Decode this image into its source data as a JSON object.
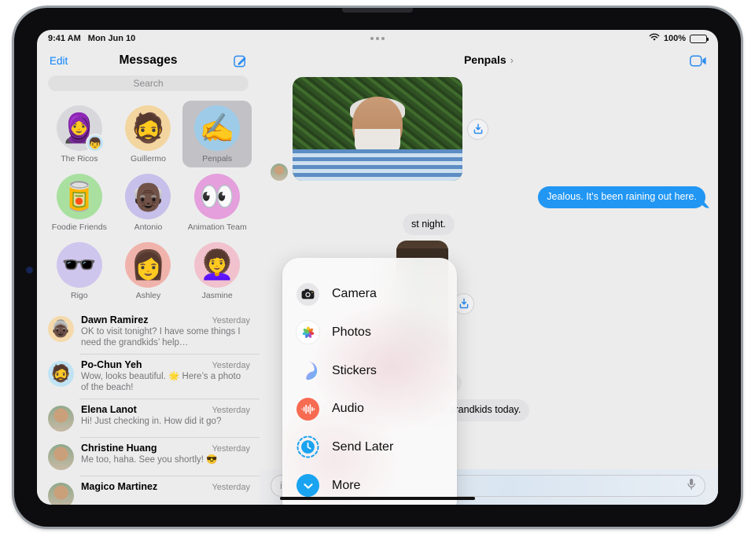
{
  "status_bar": {
    "time": "9:41 AM",
    "date": "Mon Jun 10",
    "battery_percent": "100%",
    "wifi_icon": "wifi-icon",
    "battery_icon": "battery-icon",
    "multitask_icon": "multitasking-controls-icon"
  },
  "sidebar": {
    "edit_label": "Edit",
    "title": "Messages",
    "compose_icon": "compose-icon",
    "search": {
      "placeholder": "Search",
      "value": ""
    },
    "pinned": [
      {
        "label": "The Ricos",
        "emoji": "🧕",
        "bg": "#d8d8dc",
        "selected": false,
        "sub_emoji": "👦"
      },
      {
        "label": "Guillermo",
        "emoji": "🧔",
        "bg": "#f3d5a0",
        "selected": false,
        "sub_emoji": ""
      },
      {
        "label": "Penpals",
        "emoji": "✍️",
        "bg": "#9ecbe8",
        "selected": true,
        "sub_emoji": ""
      },
      {
        "label": "Foodie Friends",
        "emoji": "🥫",
        "bg": "#a9e0a0",
        "selected": false,
        "sub_emoji": ""
      },
      {
        "label": "Antonio",
        "emoji": "👴🏿",
        "bg": "#c6c0ea",
        "selected": false,
        "sub_emoji": ""
      },
      {
        "label": "Animation Team",
        "emoji": "👀",
        "bg": "#e49fdc",
        "selected": false,
        "sub_emoji": ""
      },
      {
        "label": "Rigo",
        "emoji": "🕶️",
        "bg": "#cfc6ee",
        "selected": false,
        "sub_emoji": ""
      },
      {
        "label": "Ashley",
        "emoji": "👩",
        "bg": "#f0b3ac",
        "selected": false,
        "sub_emoji": ""
      },
      {
        "label": "Jasmine",
        "emoji": "👩‍🦱",
        "bg": "#f1c2cd",
        "selected": false,
        "sub_emoji": ""
      }
    ],
    "conversations": [
      {
        "name": "Dawn Ramirez",
        "time": "Yesterday",
        "preview": "OK to visit tonight? I have some things I need the grandkids’ help…",
        "avatar_bg": "#f5d9ab",
        "avatar_emoji": "👵🏿"
      },
      {
        "name": "Po-Chun Yeh",
        "time": "Yesterday",
        "preview": "Wow, looks beautiful. 🌟 Here’s a photo of the beach!",
        "avatar_bg": "#bfe3f4",
        "avatar_emoji": "🧔"
      },
      {
        "name": "Elena Lanot",
        "time": "Yesterday",
        "preview": "Hi! Just checking in. How did it go?",
        "avatar_bg": "#9fb8a0",
        "avatar_emoji": ""
      },
      {
        "name": "Christine Huang",
        "time": "Yesterday",
        "preview": "Me too, haha. See you shortly! 😎",
        "avatar_bg": "#e0a263",
        "avatar_emoji": ""
      },
      {
        "name": "Magico Martinez",
        "time": "Yesterday",
        "preview": "",
        "avatar_bg": "#6ba4d8",
        "avatar_emoji": ""
      }
    ]
  },
  "chat": {
    "title": "Penpals",
    "chevron": "›",
    "facetime_icon": "facetime-video-icon",
    "messages": [
      {
        "type": "photo",
        "direction": "in",
        "save_icon": "save-to-photos-icon",
        "kind": "hedge-selfie"
      },
      {
        "type": "text",
        "direction": "out",
        "text": "Jealous. It's been raining out here."
      },
      {
        "type": "text",
        "direction": "in",
        "text": "st night."
      },
      {
        "type": "photo",
        "direction": "in",
        "save_icon": "save-to-photos-icon",
        "kind": "green-door"
      },
      {
        "type": "text",
        "direction": "in",
        "text": "dress up."
      },
      {
        "type": "text",
        "direction": "in",
        "text": "with the grandkids today."
      }
    ],
    "composer": {
      "placeholder": "iMessage",
      "value": "",
      "mic_icon": "microphone-icon"
    }
  },
  "plus_menu": {
    "items": [
      {
        "label": "Camera",
        "icon": "camera-icon",
        "bg": "#e6e6e8",
        "fg": "#1c1c1e"
      },
      {
        "label": "Photos",
        "icon": "photos-icon",
        "bg": "#ffffff",
        "fg": "#ff2d55"
      },
      {
        "label": "Stickers",
        "icon": "stickers-icon",
        "bg": "transparent",
        "fg": "#8a7ce0"
      },
      {
        "label": "Audio",
        "icon": "audio-waveform-icon",
        "bg": "#f76b52",
        "fg": "#ffffff"
      },
      {
        "label": "Send Later",
        "icon": "send-later-clock-icon",
        "bg": "#ffffff",
        "fg": "#1aa3f0"
      },
      {
        "label": "More",
        "icon": "chevron-down-icon",
        "bg": "#1aa3f0",
        "fg": "#ffffff"
      }
    ]
  },
  "colors": {
    "accent_blue": "#0a84ff",
    "bubble_out": "#2196f3",
    "bubble_in": "#e2e2e4",
    "screen_bg": "#ececec",
    "selected_pin": "#c2c2c6"
  }
}
